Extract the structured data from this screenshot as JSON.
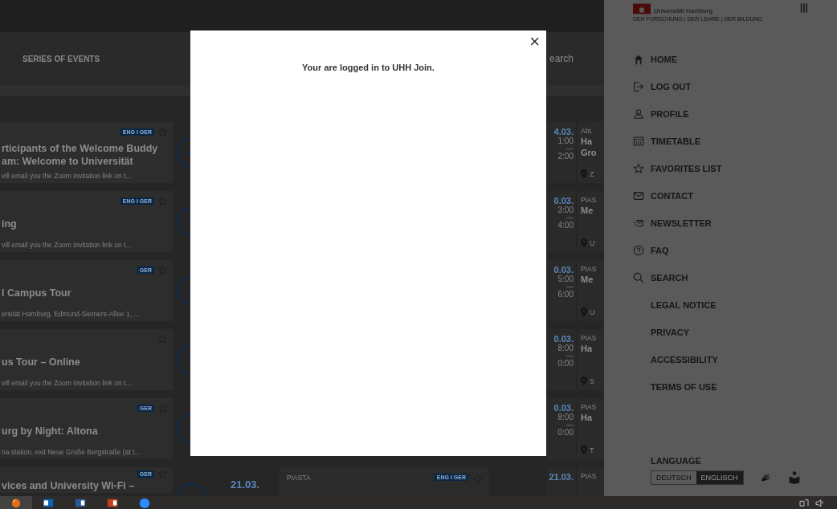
{
  "top_nav": {
    "item": "SERIES OF EVENTS",
    "search": {
      "placeholder": "earch"
    }
  },
  "event_rows": [
    {
      "left": {
        "tag": "ENG I GER",
        "title_lines": [
          "rticipants of the Welcome Buddy",
          "am: Welcome to Universität"
        ],
        "description": "vill email you the Zoom invitation link on t..."
      },
      "right": {
        "date": "4.03.",
        "start": "1:00",
        "dash": "—",
        "end": "2:00",
        "category": "Abt.",
        "title_lines": [
          "Ha",
          "Gro"
        ],
        "location": "Z"
      }
    },
    {
      "left": {
        "tag": "ENG I GER",
        "title_lines": [
          "ing"
        ],
        "description": "vill email you the Zoom invitation link on t..."
      },
      "right": {
        "date": "0.03.",
        "start": "3:00",
        "dash": "—",
        "end": "4:00",
        "category": "PIAS",
        "title_lines": [
          "Me"
        ],
        "location": "U"
      }
    },
    {
      "left": {
        "tag": "GER",
        "title_lines": [
          "l Campus Tour"
        ],
        "description": "ersität Hamburg, Edmund-Siemers-Allee 1, ..."
      },
      "right": {
        "date": "0.03.",
        "start": "5:00",
        "dash": "—",
        "end": "6:00",
        "category": "PIAS",
        "title_lines": [
          "Me"
        ],
        "location": "U"
      }
    },
    {
      "left": {
        "title_lines": [
          "us Tour – Online"
        ],
        "description": "vill email you the Zoom invitation link on t..."
      },
      "right": {
        "date": "0.03.",
        "start": "8:00",
        "dash": "—",
        "end": "0:00",
        "category": "PIAS",
        "title_lines": [
          "Ha"
        ],
        "location": "S"
      }
    },
    {
      "left": {
        "tag": "GER",
        "title_lines": [
          "urg by Night: Altona"
        ],
        "description": "na station, exit Neue Große Bergstraße (at t..."
      },
      "right": {
        "date": "0.03.",
        "start": "8:00",
        "dash": "—",
        "end": "0:00",
        "category": "PIAS",
        "title_lines": [
          "Ha"
        ],
        "location": "T"
      }
    },
    {
      "left": {
        "tag": "GER",
        "title_lines": [
          "vices and University Wi-Fi –"
        ]
      },
      "middle": {
        "date": "21.03.",
        "category": "PIASTA",
        "tag": "ENG I GER"
      },
      "right": {
        "date": "21.03.",
        "category": "PIAS"
      }
    }
  ],
  "modal": {
    "message": "Your are logged in to UHH Join.",
    "close": "×"
  },
  "sidebar": {
    "logo": {
      "name": "Universität Hamburg",
      "tagline": "DER FORSCHUNG | DER LEHRE | DER BILDUNG"
    },
    "items": [
      {
        "label": "HOME",
        "kind": "home"
      },
      {
        "label": "LOG OUT",
        "kind": "logout"
      },
      {
        "label": "PROFILE",
        "kind": "profile"
      },
      {
        "label": "TIMETABLE",
        "kind": "calendar"
      },
      {
        "label": "FAVORITES LIST",
        "kind": "star"
      },
      {
        "label": "CONTACT",
        "kind": "mail"
      },
      {
        "label": "NEWSLETTER",
        "kind": "newsletter"
      },
      {
        "label": "FAQ",
        "kind": "help"
      },
      {
        "label": "SEARCH",
        "kind": "search"
      },
      {
        "label": "LEGAL NOTICE",
        "kind": "plain"
      },
      {
        "label": "PRIVACY",
        "kind": "plain"
      },
      {
        "label": "ACCESSIBILITY",
        "kind": "plain"
      },
      {
        "label": "TERMS OF USE",
        "kind": "plain"
      }
    ],
    "language": {
      "heading": "LANGUAGE",
      "options": [
        {
          "label": "DEUTSCH",
          "selected": false
        },
        {
          "label": "ENGLISCH",
          "selected": true
        }
      ]
    }
  }
}
